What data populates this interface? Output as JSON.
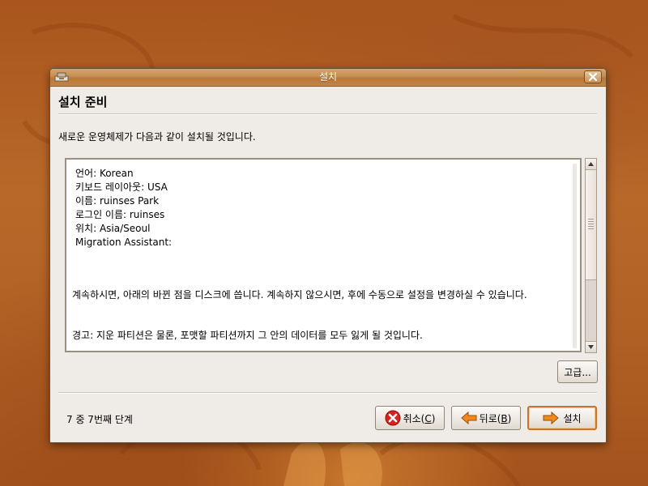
{
  "window": {
    "title": "설치"
  },
  "page": {
    "heading": "설치 준비",
    "description": "새로운 운영체제가 다음과 같이 설치될 것입니다."
  },
  "summary": {
    "items": [
      "언어: Korean",
      "키보드 레이아웃: USA",
      "이름: ruinses Park",
      "로그인 이름: ruinses",
      "위치: Asia/Seoul",
      "Migration Assistant:"
    ],
    "notice": "계속하시면, 아래의 바뀐 점을 디스크에 씁니다. 계속하지 않으시면, 후에 수동으로 설정을 변경하실 수 있습니다.",
    "warning": "경고: 지운 파티션은 물론, 포맷할 파티션까지 그 안의 데이터를 모두 잃게 될 것입니다."
  },
  "buttons": {
    "advanced": "고급...",
    "cancel_label": "취소(",
    "cancel_key": "C",
    "cancel_close": ")",
    "back_label": "뒤로(",
    "back_key": "B",
    "back_close": ")",
    "install": "설치"
  },
  "footer": {
    "step": "7 중 7번째 단계"
  },
  "colors": {
    "accent": "#c9752f",
    "titlebar": "#c68d50",
    "window_bg": "#efebe7",
    "cancel_icon": "#d8231f",
    "arrow_icon": "#f08a1c"
  },
  "icons": {
    "title": "installer-icon",
    "close": "close-icon",
    "cancel": "cancel-icon",
    "back": "arrow-left-icon",
    "install": "arrow-right-icon"
  }
}
